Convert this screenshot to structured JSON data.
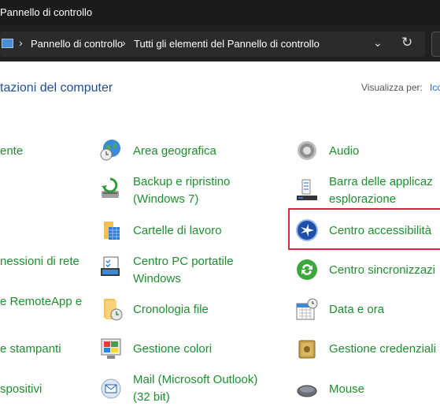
{
  "window": {
    "title": "Pannello di controllo"
  },
  "address": {
    "crumbs": [
      "Pannello di controllo",
      "Tutti gli elementi del Pannello di controllo"
    ],
    "sep": "›"
  },
  "heading": "tazioni del computer",
  "view_by": {
    "label": "Visualizza per:",
    "value": "Ico"
  },
  "col1": [
    "ente",
    "nessioni di rete",
    "e RemoteApp e",
    "e stampanti",
    "spositivi"
  ],
  "col2": [
    {
      "l1": "Area geografica",
      "icon": "globe-clock-icon"
    },
    {
      "l1": "Backup e ripristino",
      "l2": "(Windows 7)",
      "icon": "backup-icon"
    },
    {
      "l1": "Cartelle di lavoro",
      "icon": "work-folders-icon"
    },
    {
      "l1": "Centro PC portatile",
      "l2": "Windows",
      "icon": "mobility-center-icon"
    },
    {
      "l1": "Cronologia file",
      "icon": "file-history-icon"
    },
    {
      "l1": "Gestione colori",
      "icon": "color-management-icon"
    },
    {
      "l1": "Mail (Microsoft Outlook)",
      "l2": "(32 bit)",
      "icon": "mail-icon"
    }
  ],
  "col3": [
    {
      "l1": "Audio",
      "icon": "speaker-icon"
    },
    {
      "l1": "Barra delle applicaz",
      "l2": "esplorazione",
      "icon": "taskbar-icon"
    },
    {
      "l1": "Centro accessibilità",
      "icon": "accessibility-icon"
    },
    {
      "l1": "Centro sincronizzazi",
      "icon": "sync-center-icon"
    },
    {
      "l1": "Data e ora",
      "icon": "date-time-icon"
    },
    {
      "l1": "Gestione credenziali",
      "icon": "credential-manager-icon"
    },
    {
      "l1": "Mouse",
      "icon": "mouse-icon"
    }
  ],
  "colors": {
    "link_green": "#1e8f2e",
    "heading_blue": "#1e4e9a",
    "highlight": "#e0233c"
  }
}
